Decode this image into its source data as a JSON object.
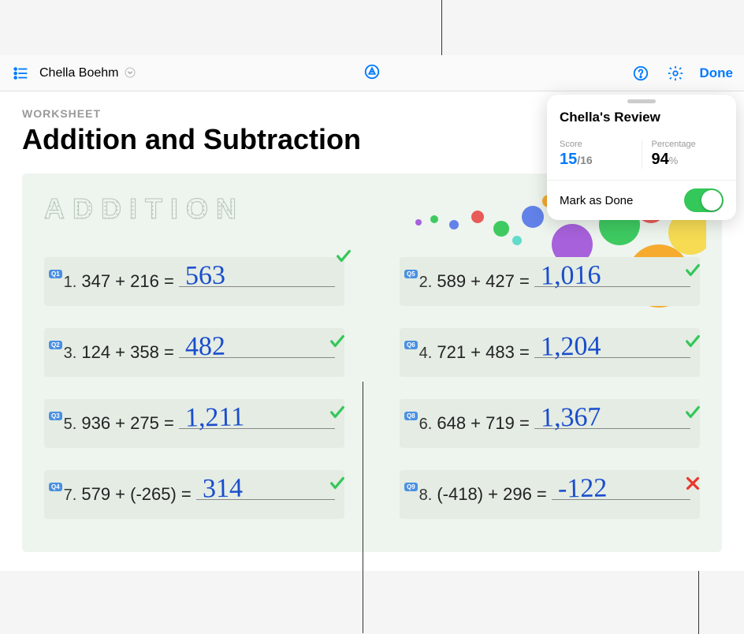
{
  "toolbar": {
    "student_name": "Chella Boehm",
    "done_label": "Done"
  },
  "worksheet": {
    "label": "WORKSHEET",
    "title": "Addition and Subtraction",
    "section": "ADDITION"
  },
  "review": {
    "title": "Chella's Review",
    "score_label": "Score",
    "score_earned": "15",
    "score_separator": "/",
    "score_total": "16",
    "percentage_label": "Percentage",
    "percentage_value": "94",
    "percentage_unit": "%",
    "mark_done_label": "Mark as Done",
    "mark_done_state": true
  },
  "questions": [
    {
      "badge": "Q1",
      "display_num": "1.",
      "problem": "347 + 216 =",
      "answer": "563",
      "correct": true
    },
    {
      "badge": "Q5",
      "display_num": "2.",
      "problem": "589 + 427 =",
      "answer": "1,016",
      "correct": true
    },
    {
      "badge": "Q2",
      "display_num": "3.",
      "problem": "124 + 358 =",
      "answer": "482",
      "correct": true
    },
    {
      "badge": "Q6",
      "display_num": "4.",
      "problem": "721 + 483 =",
      "answer": "1,204",
      "correct": true
    },
    {
      "badge": "Q3",
      "display_num": "5.",
      "problem": "936 + 275 =",
      "answer": "1,211",
      "correct": true
    },
    {
      "badge": "Q8",
      "display_num": "6.",
      "problem": "648 + 719 =",
      "answer": "1,367",
      "correct": true
    },
    {
      "badge": "Q4",
      "display_num": "7.",
      "problem": "579 + (-265) =",
      "answer": "314",
      "correct": true
    },
    {
      "badge": "Q9",
      "display_num": "8.",
      "problem": "(-418) + 296 =",
      "answer": "-122",
      "correct": false
    }
  ]
}
